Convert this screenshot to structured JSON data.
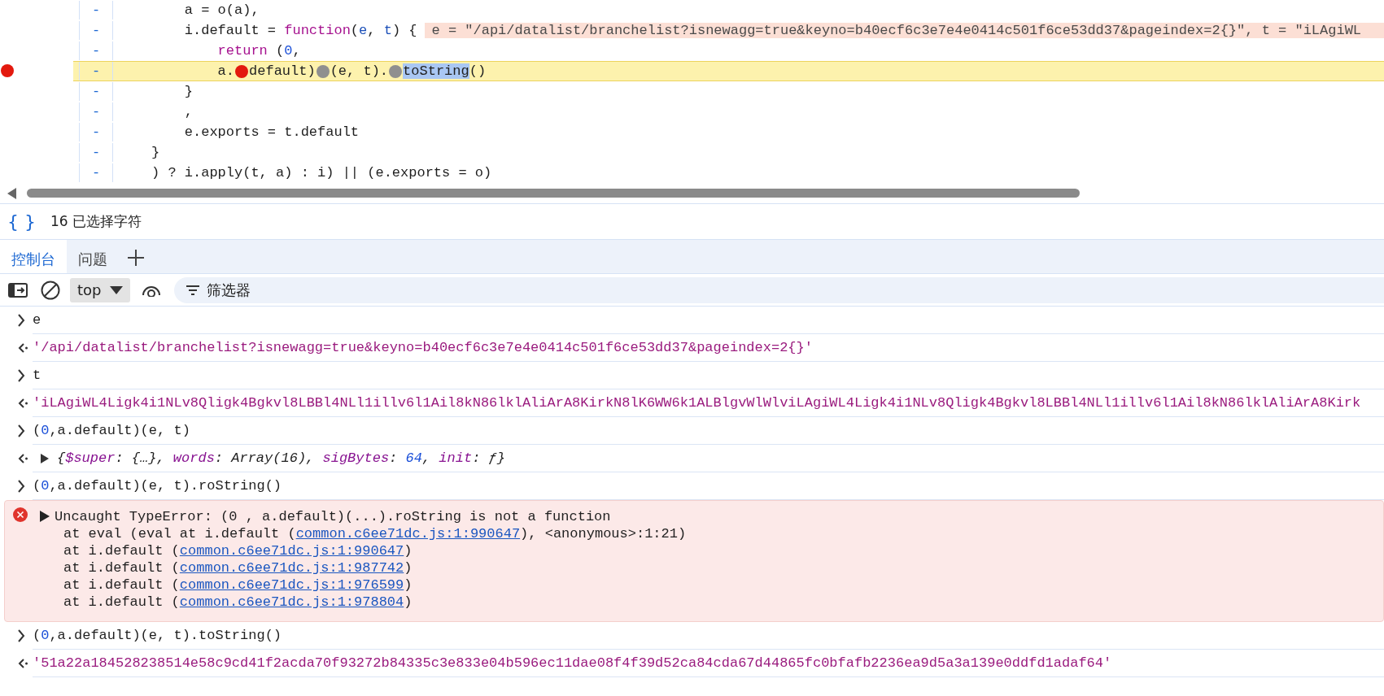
{
  "code_lines": [
    {
      "breakpoint": false,
      "highlighted": false,
      "marker": "-",
      "tokens": [
        {
          "kind": "plain",
          "text": "    a = o(a),"
        }
      ]
    },
    {
      "breakpoint": false,
      "highlighted": false,
      "marker": "-",
      "tokens": [
        {
          "kind": "plain",
          "text": "    i.default = "
        },
        {
          "kind": "keyword",
          "text": "function"
        },
        {
          "kind": "plain",
          "text": "("
        },
        {
          "kind": "param",
          "text": "e"
        },
        {
          "kind": "plain",
          "text": ", "
        },
        {
          "kind": "param",
          "text": "t"
        },
        {
          "kind": "plain",
          "text": ") {"
        }
      ],
      "hint": "e = \"/api/datalist/branchelist?isnewagg=true&keyno=b40ecf6c3e7e4e0414c501f6ce53dd37&pageindex=2{}\", t = \"iLAgiWL"
    },
    {
      "breakpoint": false,
      "highlighted": false,
      "marker": "-",
      "tokens": [
        {
          "kind": "keyword",
          "text": "        return"
        },
        {
          "kind": "plain",
          "text": " ("
        },
        {
          "kind": "number",
          "text": "0"
        },
        {
          "kind": "plain",
          "text": ","
        }
      ]
    },
    {
      "breakpoint": true,
      "highlighted": true,
      "marker": "-",
      "tokens": [
        {
          "kind": "plain",
          "text": "        a."
        },
        {
          "kind": "bp-active"
        },
        {
          "kind": "plain",
          "text": "default)"
        },
        {
          "kind": "bp-inactive"
        },
        {
          "kind": "plain",
          "text": "(e, t)."
        },
        {
          "kind": "bp-inactive"
        },
        {
          "kind": "selected",
          "text": "toString"
        },
        {
          "kind": "plain",
          "text": "()"
        }
      ]
    },
    {
      "breakpoint": false,
      "highlighted": false,
      "marker": "-",
      "tokens": [
        {
          "kind": "plain",
          "text": "    }"
        }
      ]
    },
    {
      "breakpoint": false,
      "highlighted": false,
      "marker": "-",
      "tokens": [
        {
          "kind": "plain",
          "text": "    ,"
        }
      ]
    },
    {
      "breakpoint": false,
      "highlighted": false,
      "marker": "-",
      "tokens": [
        {
          "kind": "plain",
          "text": "    e.exports = t.default"
        }
      ]
    },
    {
      "breakpoint": false,
      "highlighted": false,
      "marker": "-",
      "tokens": [
        {
          "kind": "plain",
          "text": "}"
        }
      ]
    },
    {
      "breakpoint": false,
      "highlighted": false,
      "marker": "-",
      "tokens": [
        {
          "kind": "plain",
          "text": ") ? i.apply(t, a) : i) || (e.exports = o)"
        }
      ]
    }
  ],
  "status": {
    "braces": "{ }",
    "text": "16 已选择字符"
  },
  "tabs": [
    {
      "label": "控制台",
      "selected": true
    },
    {
      "label": "问题",
      "selected": false
    }
  ],
  "toolbar": {
    "context": "top",
    "filter_placeholder": "筛选器"
  },
  "console": [
    {
      "kind": "input",
      "tokens": [
        {
          "kind": "plain",
          "text": "e"
        }
      ]
    },
    {
      "kind": "result",
      "tokens": [
        {
          "kind": "string",
          "text": "'/api/datalist/branchelist?isnewagg=true&keyno=b40ecf6c3e7e4e0414c501f6ce53dd37&pageindex=2{}'"
        }
      ]
    },
    {
      "kind": "input",
      "tokens": [
        {
          "kind": "plain",
          "text": "t"
        }
      ]
    },
    {
      "kind": "result",
      "tokens": [
        {
          "kind": "string",
          "text": "'iLAgiWL4Ligk4i1NLv8Qligk4Bgkvl8LBBl4NLl1illv6l1Ail8kN86lklAliArA8KirkN8lK6WW6k1ALBlgvWlWlviLAgiWL4Ligk4i1NLv8Qligk4Bgkvl8LBBl4NLl1illv6l1Ail8kN86lklAliArA8Kirk"
        }
      ]
    },
    {
      "kind": "input",
      "tokens": [
        {
          "kind": "plain",
          "text": "("
        },
        {
          "kind": "number",
          "text": "0"
        },
        {
          "kind": "plain",
          "text": ",a.default)(e, t)"
        }
      ]
    },
    {
      "kind": "object",
      "expanded": false,
      "tokens": [
        {
          "kind": "plain",
          "text": "{"
        },
        {
          "kind": "key",
          "text": "$super"
        },
        {
          "kind": "plain",
          "text": ": {…}, "
        },
        {
          "kind": "key",
          "text": "words"
        },
        {
          "kind": "plain",
          "text": ": Array(16), "
        },
        {
          "kind": "key",
          "text": "sigBytes"
        },
        {
          "kind": "plain",
          "text": ": "
        },
        {
          "kind": "number",
          "text": "64"
        },
        {
          "kind": "plain",
          "text": ", "
        },
        {
          "kind": "key",
          "text": "init"
        },
        {
          "kind": "plain",
          "text": ": ƒ}"
        }
      ]
    },
    {
      "kind": "input",
      "tokens": [
        {
          "kind": "plain",
          "text": "("
        },
        {
          "kind": "number",
          "text": "0"
        },
        {
          "kind": "plain",
          "text": ",a.default)(e, t).roString()"
        }
      ]
    },
    {
      "kind": "error",
      "expanded": false,
      "message": "Uncaught TypeError: (0 , a.default)(...).roString is not a function",
      "stack": [
        {
          "before": "at eval (eval at i.default (",
          "link": "common.c6ee71dc.js:1:990647",
          "after": "), <anonymous>:1:21)"
        },
        {
          "before": "at i.default (",
          "link": "common.c6ee71dc.js:1:990647",
          "after": ")"
        },
        {
          "before": "at i.default (",
          "link": "common.c6ee71dc.js:1:987742",
          "after": ")"
        },
        {
          "before": "at i.default (",
          "link": "common.c6ee71dc.js:1:976599",
          "after": ")"
        },
        {
          "before": "at i.default (",
          "link": "common.c6ee71dc.js:1:978804",
          "after": ")"
        }
      ]
    },
    {
      "kind": "input",
      "tokens": [
        {
          "kind": "plain",
          "text": "("
        },
        {
          "kind": "number",
          "text": "0"
        },
        {
          "kind": "plain",
          "text": ",a.default)(e, t).toString()"
        }
      ]
    },
    {
      "kind": "result",
      "tokens": [
        {
          "kind": "string",
          "text": "'51a22a184528238514e58c9cd41f2acda70f93272b84335c3e833e04b596ec11dae08f4f39d52ca84cda67d44865fc0bfafb2236ea9d5a3a139e0ddfd1adaf64'"
        }
      ]
    }
  ]
}
